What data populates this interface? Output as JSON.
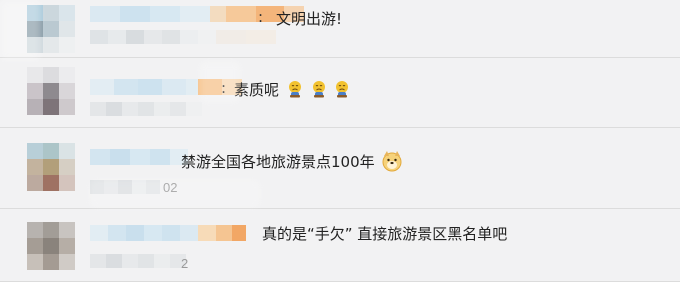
{
  "comments": [
    {
      "separator": ":",
      "text": "文明出游!",
      "time": ""
    },
    {
      "separator": ":",
      "text": "素质呢",
      "emoji": [
        "sad-emoji",
        "sad-emoji",
        "sad-emoji"
      ],
      "time": ""
    },
    {
      "separator": "",
      "text": "禁游全国各地旅游景点100年",
      "emoji": [
        "doge-emoji"
      ],
      "time": "02"
    },
    {
      "separator": "",
      "text": "真的是“手欠” 直接旅游景区黑名单吧",
      "time": "2"
    }
  ]
}
